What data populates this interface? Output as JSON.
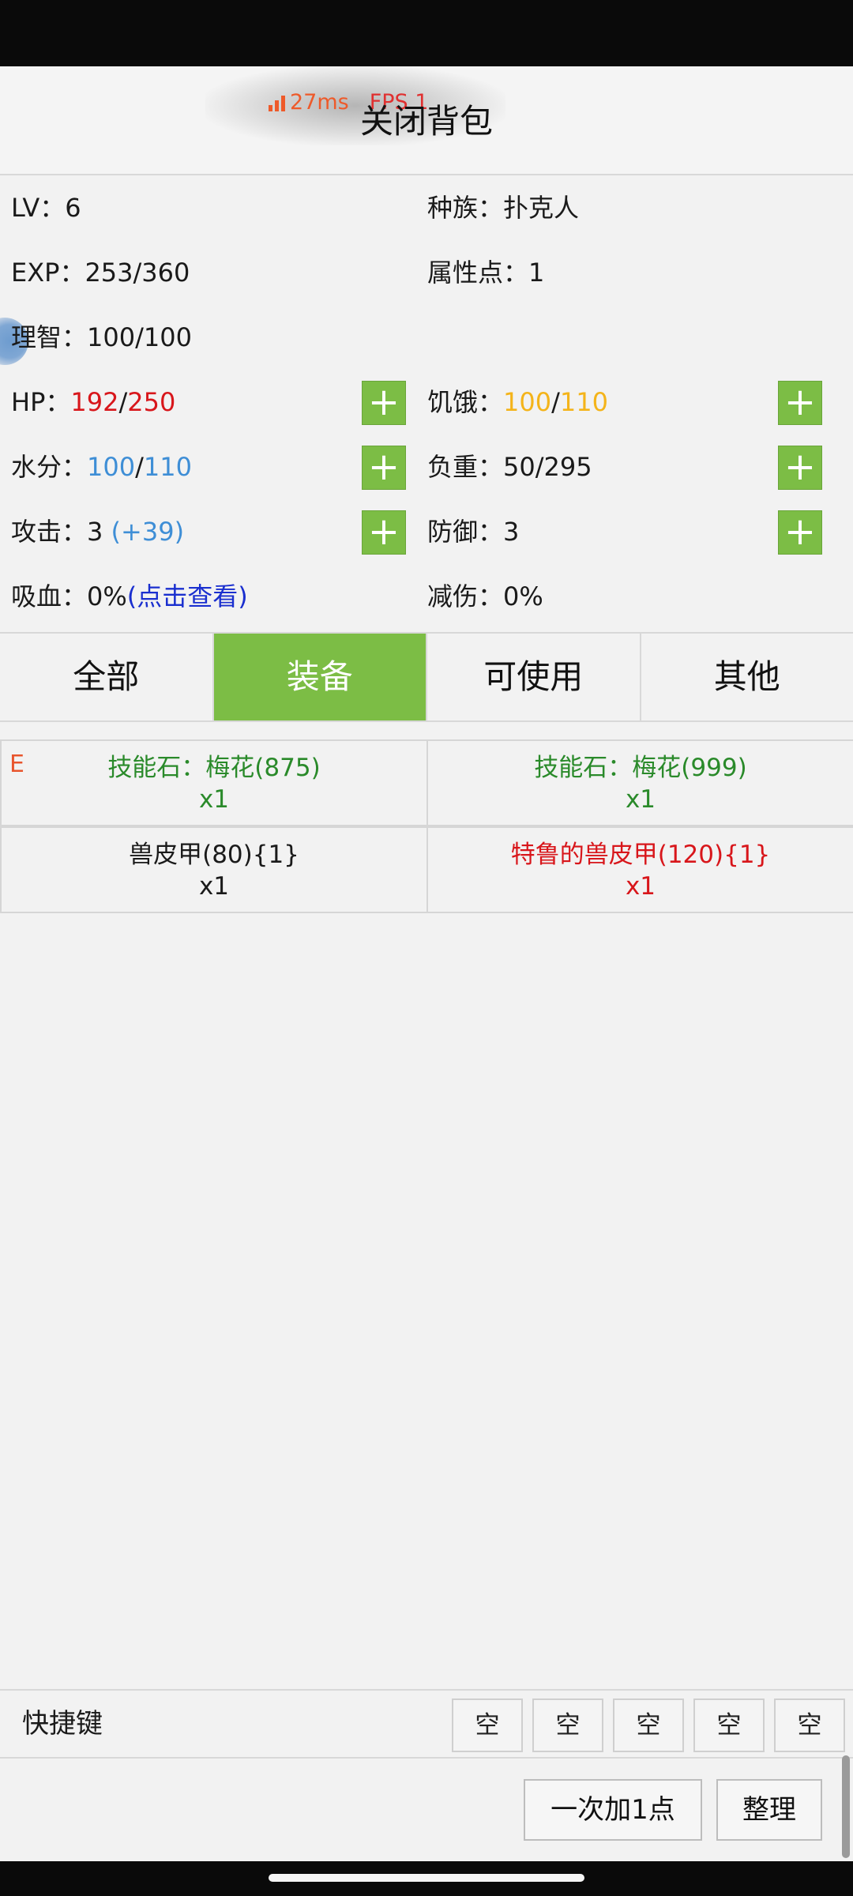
{
  "header": {
    "title": "关闭背包",
    "ping": "27ms",
    "fps": "FPS 1"
  },
  "stats": {
    "level": "LV：6",
    "race": "种族：扑克人",
    "exp": "EXP：253/360",
    "attr_points": "属性点：1",
    "sanity": "理智：100/100",
    "hp_label": "HP：",
    "hp_current": "192",
    "hp_max": "250",
    "hunger_label": "饥饿：",
    "hunger_current": "100",
    "hunger_max": "110",
    "water_label": "水分：",
    "water_current": "100",
    "water_max": "110",
    "load": "负重：50/295",
    "attack_label": "攻击：3 ",
    "attack_bonus": "(+39)",
    "defense": "防御：3",
    "lifesteal_label": "吸血：0%",
    "lifesteal_link": "(点击查看)",
    "damage_reduction": "减伤：0%",
    "slash": "/",
    "plus": "+"
  },
  "tabs": [
    {
      "label": "全部"
    },
    {
      "label": "装备"
    },
    {
      "label": "可使用"
    },
    {
      "label": "其他"
    }
  ],
  "active_tab": "装备",
  "items": [
    {
      "name": "技能石：梅花(875)",
      "qty": "x1",
      "equipped_mark": "E",
      "color": "#2a8a2a"
    },
    {
      "name": "技能石：梅花(999)",
      "qty": "x1",
      "color": "#2a8a2a"
    },
    {
      "name": "兽皮甲(80){1}",
      "qty": "x1",
      "color": "#1a1a1a"
    },
    {
      "name": "特鲁的兽皮甲(120){1}",
      "qty": "x1",
      "color": "#d8161b"
    }
  ],
  "shortcut": {
    "label": "快捷键",
    "slots": [
      "空",
      "空",
      "空",
      "空",
      "空"
    ]
  },
  "actions": {
    "add_one": "一次加1点",
    "sort": "整理"
  },
  "colors": {
    "accent_green": "#7cbd45",
    "hp_red": "#d8161b",
    "hunger_orange": "#f4b41a",
    "water_blue": "#3e8ed6",
    "link_blue": "#1a2fcf"
  }
}
